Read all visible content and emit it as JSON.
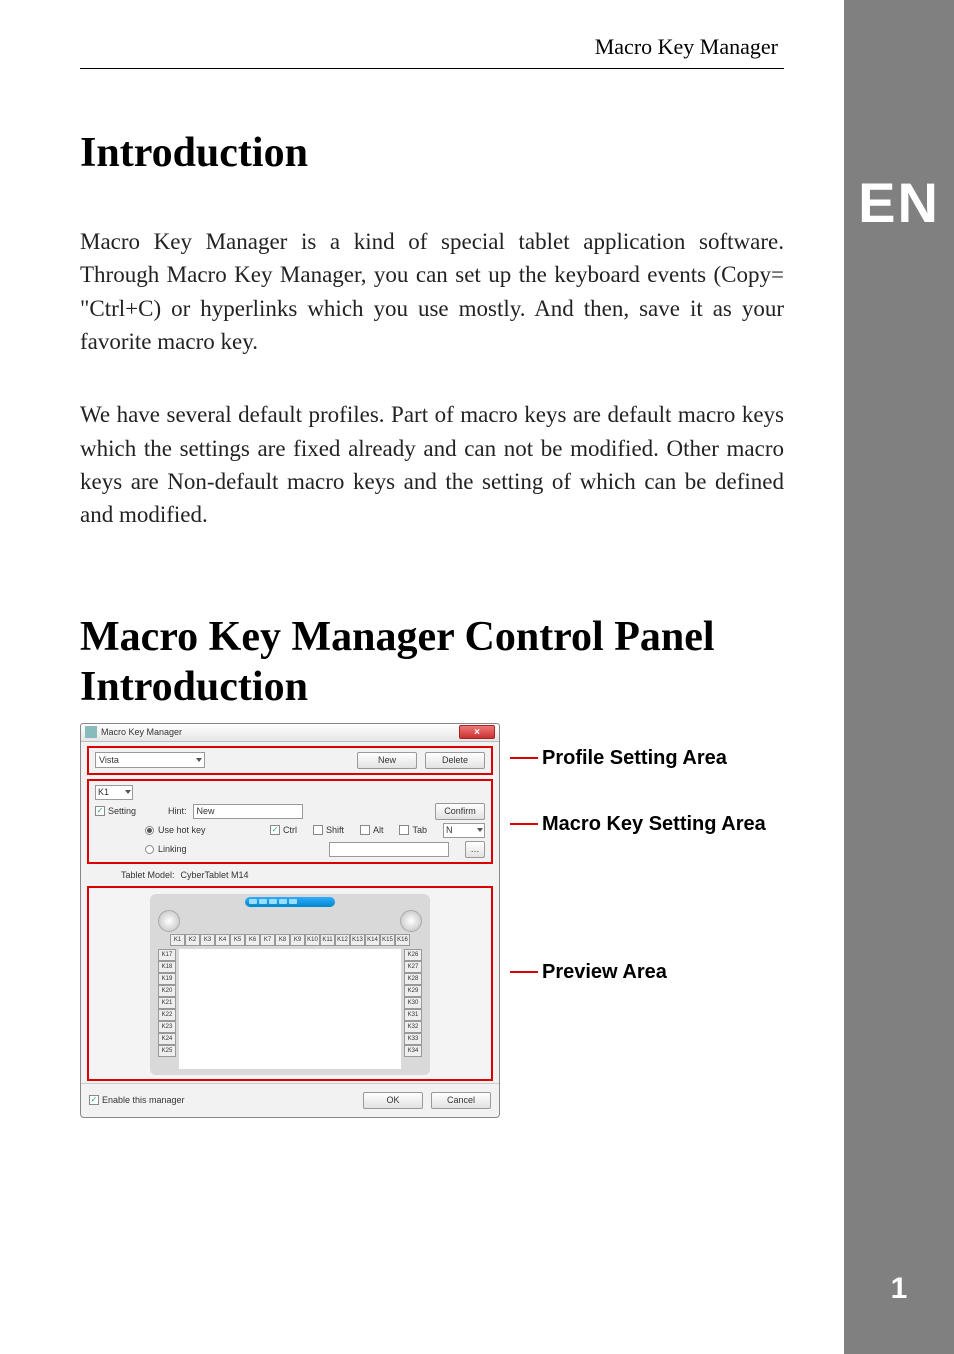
{
  "header": {
    "title": "Macro Key Manager"
  },
  "section1": {
    "heading": "Introduction",
    "para1": "Macro Key Manager is a kind of special tablet application software. Through Macro Key Manager, you can set up the keyboard events (Copy=  \"Ctrl+C)   or hyperlinks   which you use  mostly. And  then, save it as your favorite macro key.",
    "para2": "We  have  several  default  profiles.  Part  of  macro  keys  are  default macro keys which the settings are fixed already and can not be modified. Other macro keys are Non-default macro keys and the setting of which can be defined and modified."
  },
  "section2": {
    "heading": "Macro Key Manager Control Panel Introduction"
  },
  "sidebar": {
    "lang": "EN",
    "page": "1"
  },
  "app": {
    "title": "Macro Key Manager",
    "close": "×",
    "profile": {
      "selected": "Vista",
      "new_btn": "New",
      "delete_btn": "Delete"
    },
    "macro": {
      "key_selected": "K1",
      "setting_label": "Setting",
      "setting_checked": true,
      "hint_label": "Hint:",
      "hint_value": "New",
      "confirm_btn": "Confirm",
      "hotkey_label": "Use hot key",
      "hotkey_checked": true,
      "mods": {
        "ctrl": "Ctrl",
        "ctrl_checked": true,
        "shift": "Shift",
        "shift_checked": false,
        "alt": "Alt",
        "alt_checked": false,
        "tab": "Tab",
        "tab_checked": false
      },
      "key_field": "N",
      "linking_label": "Linking",
      "linking_checked": false,
      "browse_btn": "…"
    },
    "tablet_model_label": "Tablet Model:",
    "tablet_model_value": "CyberTablet M14",
    "keys_top": [
      "K1",
      "K2",
      "K3",
      "K4",
      "K5",
      "K6",
      "K7",
      "K8",
      "K9",
      "K10",
      "K11",
      "K12",
      "K13",
      "K14",
      "K15",
      "K16"
    ],
    "keys_left": [
      "K17",
      "K18",
      "K19",
      "K20",
      "K21",
      "K22",
      "K23",
      "K24",
      "K25"
    ],
    "keys_right": [
      "K26",
      "K27",
      "K28",
      "K29",
      "K30",
      "K31",
      "K32",
      "K33",
      "K34"
    ],
    "enable_label": "Enable this manager",
    "enable_checked": true,
    "ok_btn": "OK",
    "cancel_btn": "Cancel"
  },
  "annotations": {
    "a1": "Profile Setting Area",
    "a2": "Macro Key Setting Area",
    "a3": "Preview Area"
  }
}
